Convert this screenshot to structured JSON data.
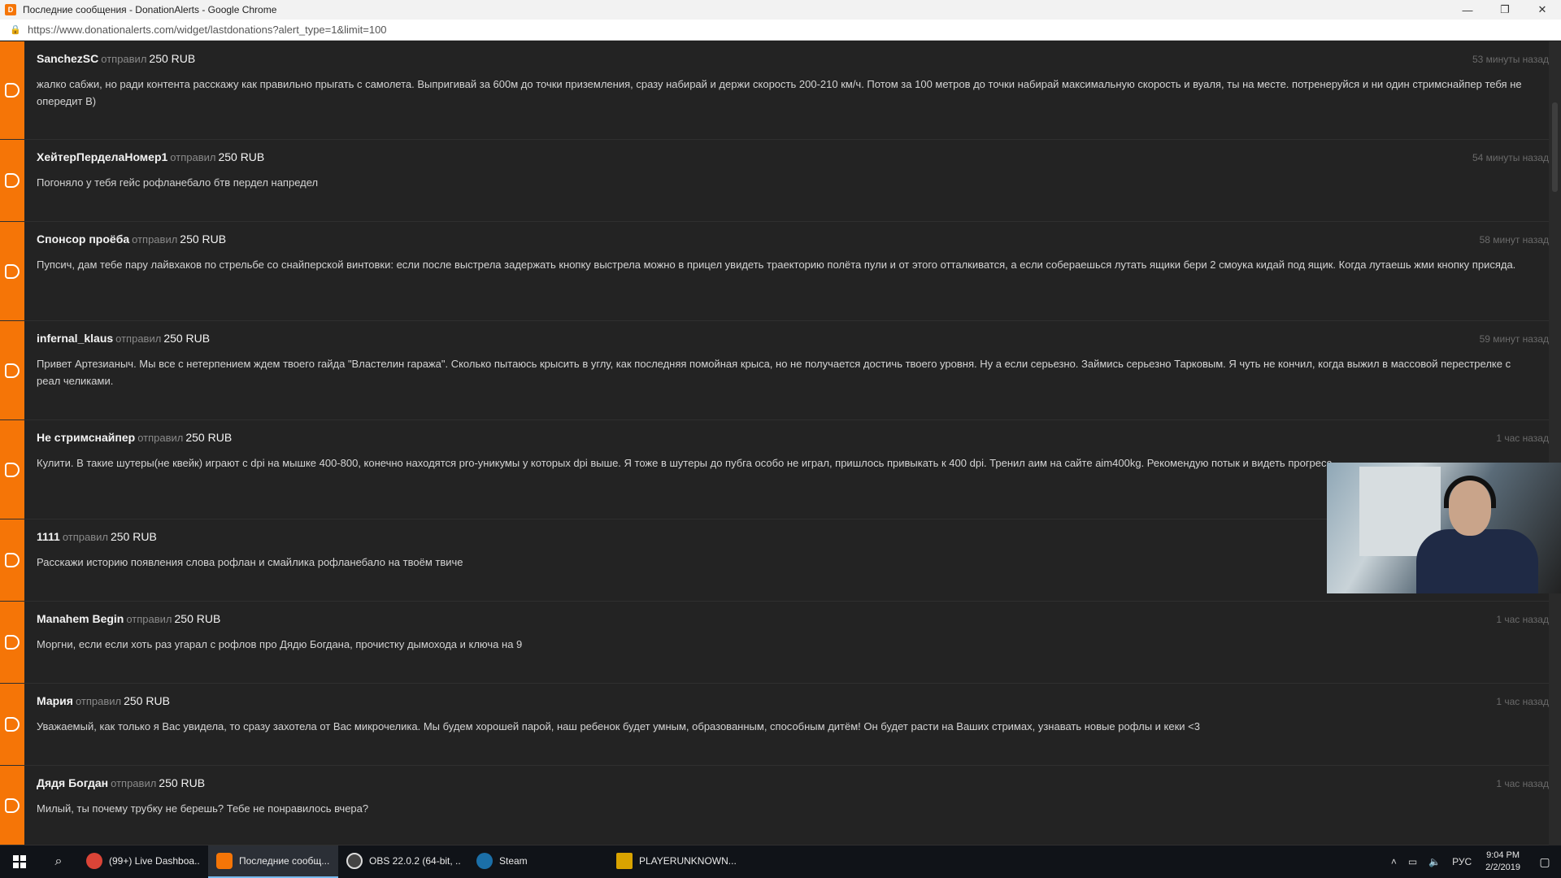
{
  "window": {
    "title": "Последние сообщения - DonationAlerts - Google Chrome",
    "minimize": "—",
    "restore": "❐",
    "close": "✕"
  },
  "address": {
    "url": "https://www.donationalerts.com/widget/lastdonations?alert_type=1&limit=100"
  },
  "donations": [
    {
      "user": "SanchezSC",
      "verb": "отправил",
      "amount": "250 RUB",
      "time": "53 минуты назад",
      "message": "жалко сабжи, но ради контента расскажу как правильно прыгать с самолета. Выпригивай за 600м до точки приземления, сразу набирай и держи скорость 200-210 км/ч. Потом за 100 метров до точки набирай максимальную скорость и вуаля, ты на месте. потренеруйся и ни один стримснайпер тебя не опередит B)"
    },
    {
      "user": "ХейтерПерделаНомер1",
      "verb": "отправил",
      "amount": "250 RUB",
      "time": "54 минуты назад",
      "message": "Погоняло у тебя гейс рофланебало бтв пердел напредел"
    },
    {
      "user": "Спонсор проёба",
      "verb": "отправил",
      "amount": "250 RUB",
      "time": "58 минут назад",
      "message": "Пупсич, дам тебе пару лайвхаков по стрельбе со снайперской винтовки: если после выстрела задержать кнопку выстрела можно в прицел увидеть траекторию полёта пули и от этого отталкиватся, а если собераешься лутать ящики бери 2 смоука кидай под ящик. Когда лутаешь жми кнопку присяда."
    },
    {
      "user": "infernal_klaus",
      "verb": "отправил",
      "amount": "250 RUB",
      "time": "59 минут назад",
      "message": "Привет Артезианыч. Мы все с нетерпением ждем твоего гайда \"Властелин гаража\". Сколько пытаюсь крысить в углу, как последняя помойная крыса, но не получается достичь твоего уровня. Ну а если серьезно. Займись серьезно Тарковым. Я чуть не кончил, когда выжил в массовой перестрелке с реал челиками."
    },
    {
      "user": "Не стримснайпер",
      "verb": "отправил",
      "amount": "250 RUB",
      "time": "1 час назад",
      "message": "Кулити. В такие шутеры(не квейк) играют с dpi на мышке 400-800, конечно находятся pro-уникумы у которых dpi выше. Я тоже в шутеры до пубга особо не играл, пришлось привыкать к 400 dpi. Тренил аим на сайте aim400kg. Рекомендую потык и видеть прогресс."
    },
    {
      "user": "1111",
      "verb": "отправил",
      "amount": "250 RUB",
      "time": "",
      "message": "Расскажи историю появления слова рофлан и смайлика рофланебало на твоём твиче"
    },
    {
      "user": "Manahem Begin",
      "verb": "отправил",
      "amount": "250 RUB",
      "time": "1 час назад",
      "message": "Моргни, если если хоть раз угарал с рофлов про Дядю Богдана, прочистку дымохода и ключа на 9"
    },
    {
      "user": "Мария",
      "verb": "отправил",
      "amount": "250 RUB",
      "time": "1 час назад",
      "message": "Уважаемый, как только я Вас увидела, то сразу захотела от Вас микрочелика. Мы будем хорошей парой, наш ребенок будет умным, образованным, способным дитём! Он будет расти на Ваших стримах, узнавать новые рофлы и кеки <3"
    },
    {
      "user": "Дядя Богдан",
      "verb": "отправил",
      "amount": "250 RUB",
      "time": "1 час назад",
      "message": "Милый, ты почему трубку не берешь? Тебе не понравилось вчера?"
    }
  ],
  "taskbar": {
    "items": [
      {
        "label": "(99+) Live Dashboa...",
        "icon": "chrome-icon",
        "color": "#db4437"
      },
      {
        "label": "Последние сообщ...",
        "icon": "donationalerts-icon",
        "color": "#f57507"
      },
      {
        "label": "OBS 22.0.2 (64-bit, ...",
        "icon": "obs-icon",
        "color": "#444444"
      },
      {
        "label": "Steam",
        "icon": "steam-icon",
        "color": "#1b6fa8"
      },
      {
        "label": "PLAYERUNKNOWN...",
        "icon": "pubg-icon",
        "color": "#d9a300"
      }
    ],
    "lang": "РУС",
    "time": "9:04 PM",
    "date": "2/2/2019"
  }
}
